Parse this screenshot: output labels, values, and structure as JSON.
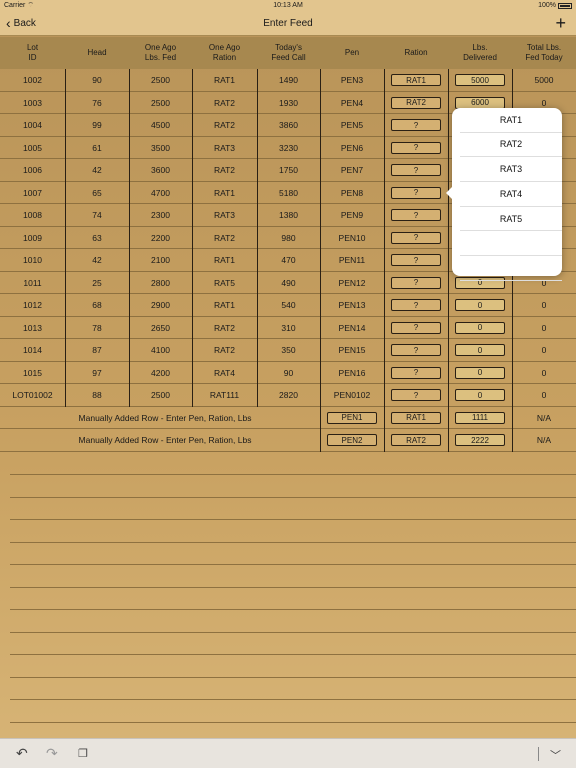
{
  "status_bar": {
    "carrier": "Carrier",
    "time": "10:13 AM",
    "battery": "100%"
  },
  "nav": {
    "back_label": "Back",
    "title": "Enter Feed",
    "add_label": "+"
  },
  "table": {
    "columns": [
      "Lot ID",
      "Head",
      "One Ago Lbs. Fed",
      "One Ago Ration",
      "Today's Feed Call",
      "Pen",
      "Ration",
      "Lbs. Delivered",
      "Total Lbs. Fed Today"
    ],
    "column_labels": [
      [
        "Lot",
        "ID"
      ],
      [
        "Head",
        ""
      ],
      [
        "One Ago",
        "Lbs. Fed"
      ],
      [
        "One Ago",
        "Ration"
      ],
      [
        "Today's",
        "Feed Call"
      ],
      [
        "Pen",
        ""
      ],
      [
        "Ration",
        ""
      ],
      [
        "Lbs.",
        "Delivered"
      ],
      [
        "Total Lbs.",
        "Fed Today"
      ]
    ],
    "rows": [
      {
        "lot": "1002",
        "head": "90",
        "ago_lbs": "2500",
        "ago_ration": "RAT1",
        "feed_call": "1490",
        "pen": "PEN3",
        "ration": "RAT1",
        "delivered": "5000",
        "total": "5000"
      },
      {
        "lot": "1003",
        "head": "76",
        "ago_lbs": "2500",
        "ago_ration": "RAT2",
        "feed_call": "1930",
        "pen": "PEN4",
        "ration": "RAT2",
        "delivered": "6000",
        "total": "0"
      },
      {
        "lot": "1004",
        "head": "99",
        "ago_lbs": "4500",
        "ago_ration": "RAT2",
        "feed_call": "3860",
        "pen": "PEN5",
        "ration": "?",
        "delivered": "",
        "total": ""
      },
      {
        "lot": "1005",
        "head": "61",
        "ago_lbs": "3500",
        "ago_ration": "RAT3",
        "feed_call": "3230",
        "pen": "PEN6",
        "ration": "?",
        "delivered": "",
        "total": ""
      },
      {
        "lot": "1006",
        "head": "42",
        "ago_lbs": "3600",
        "ago_ration": "RAT2",
        "feed_call": "1750",
        "pen": "PEN7",
        "ration": "?",
        "delivered": "",
        "total": ""
      },
      {
        "lot": "1007",
        "head": "65",
        "ago_lbs": "4700",
        "ago_ration": "RAT1",
        "feed_call": "5180",
        "pen": "PEN8",
        "ration": "?",
        "delivered": "",
        "total": ""
      },
      {
        "lot": "1008",
        "head": "74",
        "ago_lbs": "2300",
        "ago_ration": "RAT3",
        "feed_call": "1380",
        "pen": "PEN9",
        "ration": "?",
        "delivered": "",
        "total": ""
      },
      {
        "lot": "1009",
        "head": "63",
        "ago_lbs": "2200",
        "ago_ration": "RAT2",
        "feed_call": "980",
        "pen": "PEN10",
        "ration": "?",
        "delivered": "",
        "total": ""
      },
      {
        "lot": "1010",
        "head": "42",
        "ago_lbs": "2100",
        "ago_ration": "RAT1",
        "feed_call": "470",
        "pen": "PEN11",
        "ration": "?",
        "delivered": "",
        "total": ""
      },
      {
        "lot": "1011",
        "head": "25",
        "ago_lbs": "2800",
        "ago_ration": "RAT5",
        "feed_call": "490",
        "pen": "PEN12",
        "ration": "?",
        "delivered": "0",
        "total": "0"
      },
      {
        "lot": "1012",
        "head": "68",
        "ago_lbs": "2900",
        "ago_ration": "RAT1",
        "feed_call": "540",
        "pen": "PEN13",
        "ration": "?",
        "delivered": "0",
        "total": "0"
      },
      {
        "lot": "1013",
        "head": "78",
        "ago_lbs": "2650",
        "ago_ration": "RAT2",
        "feed_call": "310",
        "pen": "PEN14",
        "ration": "?",
        "delivered": "0",
        "total": "0"
      },
      {
        "lot": "1014",
        "head": "87",
        "ago_lbs": "4100",
        "ago_ration": "RAT2",
        "feed_call": "350",
        "pen": "PEN15",
        "ration": "?",
        "delivered": "0",
        "total": "0"
      },
      {
        "lot": "1015",
        "head": "97",
        "ago_lbs": "4200",
        "ago_ration": "RAT4",
        "feed_call": "90",
        "pen": "PEN16",
        "ration": "?",
        "delivered": "0",
        "total": "0"
      },
      {
        "lot": "LOT01002",
        "head": "88",
        "ago_lbs": "2500",
        "ago_ration": "RAT111",
        "feed_call": "2820",
        "pen": "PEN0102",
        "ration": "?",
        "delivered": "0",
        "total": "0"
      }
    ],
    "manual_rows": [
      {
        "label": "Manually Added Row - Enter Pen, Ration, Lbs",
        "pen": "PEN1",
        "ration": "RAT1",
        "delivered": "1111",
        "total": "N/A"
      },
      {
        "label": "Manually Added Row - Enter Pen, Ration, Lbs",
        "pen": "PEN2",
        "ration": "RAT2",
        "delivered": "2222",
        "total": "N/A"
      }
    ]
  },
  "ration_popover": {
    "options": [
      "RAT1",
      "RAT2",
      "RAT3",
      "RAT4",
      "RAT5",
      "",
      ""
    ]
  },
  "toolbar": {
    "undo_icon": "undo-icon",
    "redo_icon": "redo-icon",
    "paste_icon": "clipboard-icon",
    "dismiss_icon": "chevron-down-icon"
  }
}
